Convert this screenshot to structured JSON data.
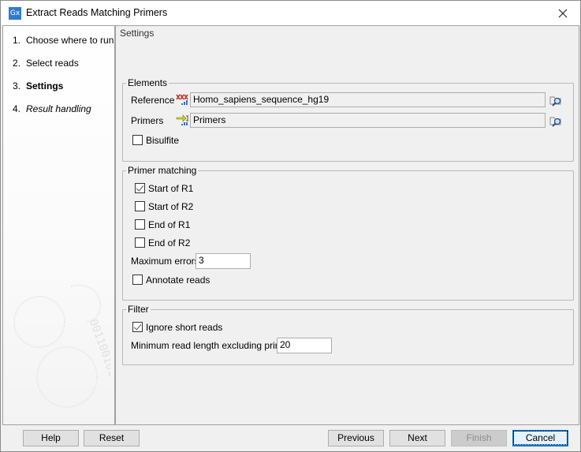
{
  "window": {
    "title": "Extract Reads Matching Primers",
    "app_icon_text": "Gx",
    "close_symbol": "✕"
  },
  "steps": [
    {
      "num": "1.",
      "label": "Choose where to run",
      "state": "done"
    },
    {
      "num": "2.",
      "label": "Select reads",
      "state": "done"
    },
    {
      "num": "3.",
      "label": "Settings",
      "state": "current"
    },
    {
      "num": "4.",
      "label": "Result handling",
      "state": "future"
    }
  ],
  "main": {
    "title": "Settings",
    "elements": {
      "legend": "Elements",
      "reference_label": "Reference",
      "reference_value": "Homo_sapiens_sequence_hg19",
      "primers_label": "Primers",
      "primers_value": "Primers",
      "bisulfite_label": "Bisulfite",
      "bisulfite_checked": false
    },
    "primer_matching": {
      "legend": "Primer matching",
      "options": [
        {
          "label": "Start of R1",
          "checked": true
        },
        {
          "label": "Start of R2",
          "checked": false
        },
        {
          "label": "End of R1",
          "checked": false
        },
        {
          "label": "End of R2",
          "checked": false
        }
      ],
      "max_errors_label": "Maximum errors",
      "max_errors_value": "3",
      "annotate_label": "Annotate reads",
      "annotate_checked": false
    },
    "filter": {
      "legend": "Filter",
      "ignore_short_label": "Ignore short reads",
      "ignore_short_checked": true,
      "min_length_label": "Minimum read length excluding primer",
      "min_length_value": "20"
    }
  },
  "buttons": {
    "help": "Help",
    "reset": "Reset",
    "previous": "Previous",
    "next": "Next",
    "finish": "Finish",
    "cancel": "Cancel"
  },
  "colors": {
    "accent": "#0078d7",
    "app_icon": "#2e7bcf"
  }
}
